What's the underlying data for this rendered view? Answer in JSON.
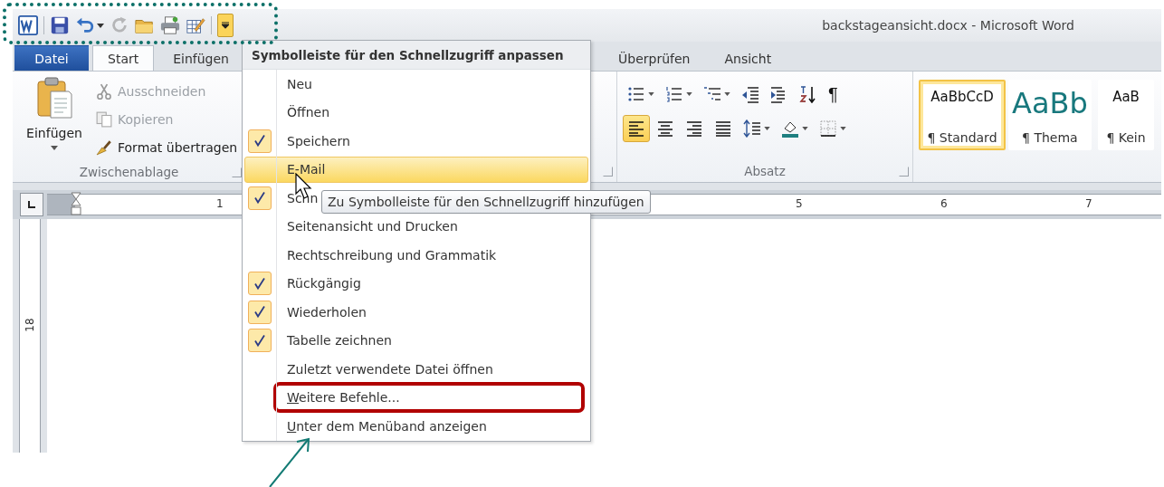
{
  "quick_access_toolbar": {
    "buttons": [
      {
        "kind": "word-logo",
        "disabled": false
      },
      {
        "kind": "separator"
      },
      {
        "kind": "save",
        "disabled": false
      },
      {
        "kind": "undo",
        "disabled": false
      },
      {
        "kind": "dropdown"
      },
      {
        "kind": "redo",
        "disabled": true
      },
      {
        "kind": "open",
        "disabled": false
      },
      {
        "kind": "print",
        "disabled": false
      },
      {
        "kind": "draw-table",
        "disabled": false
      },
      {
        "kind": "separator"
      },
      {
        "kind": "customize"
      }
    ],
    "customize_pressed": true
  },
  "window": {
    "title": "backstageansicht.docx  -  Microsoft Word"
  },
  "tabs": [
    {
      "label": "Datei",
      "kind": "file",
      "selected": false
    },
    {
      "label": "Start",
      "kind": "tab",
      "selected": true
    },
    {
      "label": "Einfügen",
      "kind": "tab",
      "selected": false
    },
    {
      "label": "Überprüfen",
      "kind": "tab",
      "selected": false
    },
    {
      "label": "Ansicht",
      "kind": "tab",
      "selected": false
    }
  ],
  "ribbon": {
    "clipboard": {
      "label": "Zwischenablage",
      "paste_label": "Einfügen",
      "items": [
        {
          "label": "Ausschneiden",
          "kind": "cut",
          "disabled": true
        },
        {
          "label": "Kopieren",
          "kind": "copy",
          "disabled": true
        },
        {
          "label": "Format übertragen",
          "kind": "format-painter",
          "disabled": false
        }
      ]
    },
    "paragraph": {
      "label": "Absatz",
      "rows": [
        [
          {
            "kind": "bullets",
            "dropdown": true,
            "selected": false
          },
          {
            "kind": "numbering",
            "dropdown": true,
            "selected": false
          },
          {
            "kind": "multilevel",
            "dropdown": true,
            "selected": false
          },
          {
            "kind": "outdent",
            "selected": false
          },
          {
            "kind": "indent",
            "selected": false
          },
          {
            "kind": "sort",
            "selected": false
          },
          {
            "kind": "pilcrow",
            "glyph": "¶",
            "selected": false
          }
        ],
        [
          {
            "kind": "align-left",
            "selected": true
          },
          {
            "kind": "align-center",
            "selected": false
          },
          {
            "kind": "align-right",
            "selected": false
          },
          {
            "kind": "justify",
            "selected": false
          },
          {
            "kind": "line-spacing",
            "dropdown": true,
            "selected": false
          },
          {
            "kind": "shading",
            "dropdown": true,
            "selected": false
          },
          {
            "kind": "borders",
            "dropdown": true,
            "selected": false
          }
        ]
      ]
    },
    "styles": [
      {
        "sample": "AaBbCcD",
        "name": "¶ Standard",
        "kind": "normal",
        "selected": true
      },
      {
        "sample": "AaBb",
        "name": "¶ Thema",
        "kind": "title",
        "selected": false
      },
      {
        "sample": "AaB",
        "name": "¶ Kein",
        "kind": "normal",
        "selected": false
      }
    ]
  },
  "horizontal_ruler": {
    "labels": [
      "1",
      "5",
      "6",
      "7"
    ]
  },
  "vertical_ruler": {
    "labels": [
      "18"
    ]
  },
  "customize_menu": {
    "title": "Symbolleiste für den Schnellzugriff anpassen",
    "items": [
      {
        "label": "Neu",
        "checked": false,
        "selected": false,
        "underline_first": false
      },
      {
        "label": "Öffnen",
        "checked": false,
        "selected": false,
        "underline_first": false
      },
      {
        "label": "Speichern",
        "checked": true,
        "selected": false,
        "underline_first": false
      },
      {
        "label": "E-Mail",
        "checked": false,
        "selected": true,
        "underline_first": false
      },
      {
        "label": "Schn",
        "checked": true,
        "selected": false,
        "underline_first": false
      },
      {
        "label": "Seitenansicht und Drucken",
        "checked": false,
        "selected": false,
        "underline_first": false
      },
      {
        "label": "Rechtschreibung und Grammatik",
        "checked": false,
        "selected": false,
        "underline_first": false
      },
      {
        "label": "Rückgängig",
        "checked": true,
        "selected": false,
        "underline_first": false
      },
      {
        "label": "Wiederholen",
        "checked": true,
        "selected": false,
        "underline_first": false
      },
      {
        "label": "Tabelle zeichnen",
        "checked": true,
        "selected": false,
        "underline_first": false
      },
      {
        "label": "Zuletzt verwendete Datei öffnen",
        "checked": false,
        "selected": false,
        "underline_first": false
      },
      {
        "label": "Weitere Befehle...",
        "checked": false,
        "selected": false,
        "underline_first": true
      },
      {
        "label": "Unter dem Menüband anzeigen",
        "checked": false,
        "selected": false,
        "underline_first": true
      }
    ],
    "tooltip": "Zu Symbolleiste für den Schnellzugriff hinzufügen"
  },
  "annotations": [
    {
      "kind": "dotted-frame"
    },
    {
      "kind": "red-frame"
    },
    {
      "kind": "arrow"
    }
  ]
}
